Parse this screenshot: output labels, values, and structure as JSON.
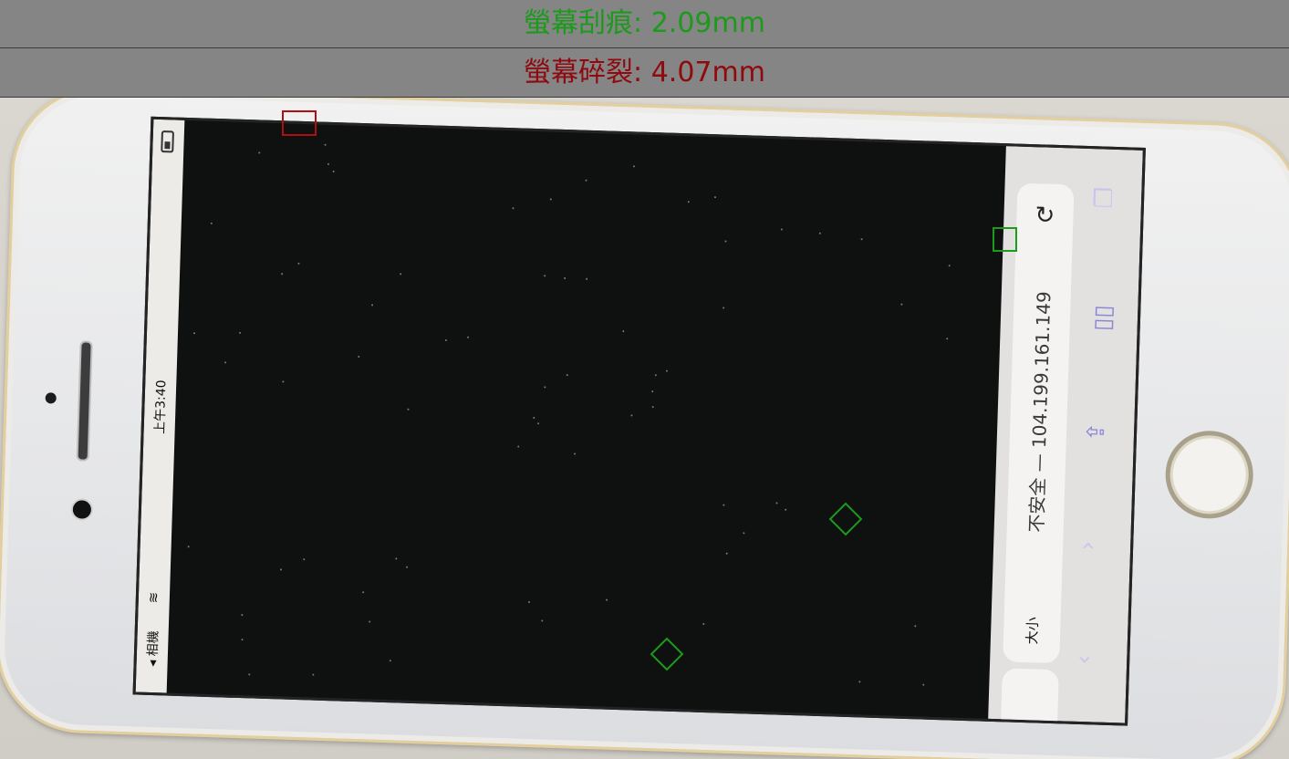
{
  "overlay": {
    "scratch_label": "螢幕刮痕: 2.09mm",
    "crack_label": "螢幕碎裂: 4.07mm",
    "scratch_color": "#1b9a1b",
    "crack_color": "#b10e14"
  },
  "phone_screen": {
    "status_time": "上午3:40",
    "status_back": "◂ 相機",
    "url_text": "不安全 — 104.199.161.149",
    "reader_label": "大小",
    "reload_icon": "↻"
  },
  "detections": {
    "crack_count": 1,
    "scratch_count": 3
  }
}
